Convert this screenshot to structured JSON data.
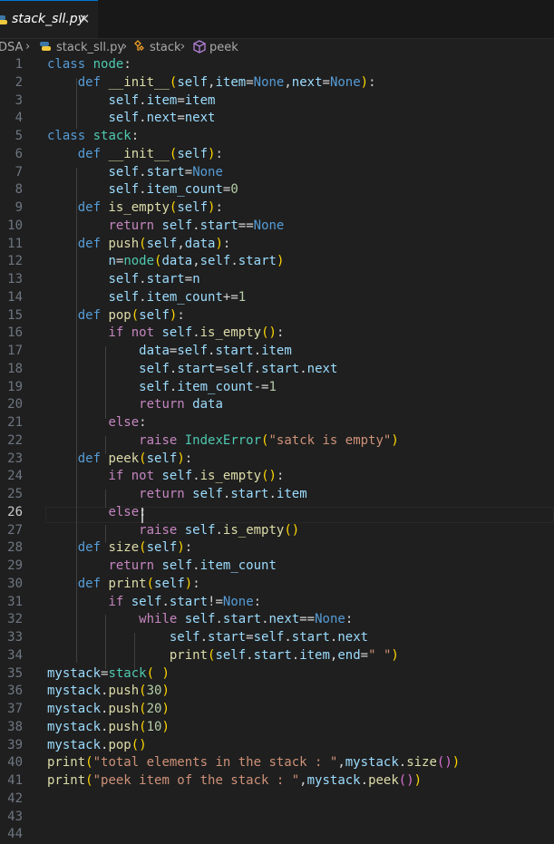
{
  "tabs": [
    {
      "label": "stack_sll.py",
      "active": true
    }
  ],
  "breadcrumb": [
    "DSA",
    "stack_sll.py",
    "stack",
    "peek"
  ],
  "editor": {
    "line_numbers": [
      "1",
      "2",
      "3",
      "4",
      "5",
      "6",
      "7",
      "8",
      "9",
      "10",
      "11",
      "12",
      "13",
      "14",
      "15",
      "16",
      "17",
      "18",
      "19",
      "20",
      "21",
      "22",
      "23",
      "24",
      "25",
      "26",
      "27",
      "28",
      "29",
      "30",
      "31",
      "32",
      "33",
      "34",
      "35",
      "36",
      "37",
      "38",
      "39",
      "40",
      "41",
      "42",
      "43",
      "44"
    ],
    "active_line": "26",
    "code_lines": [
      "class node:",
      "    def __init__(self,item=None,next=None):",
      "        self.item=item",
      "        self.next=next",
      "class stack:",
      "    def __init__(self):",
      "        self.start=None",
      "        self.item_count=0",
      "    def is_empty(self):",
      "        return self.start==None",
      "    def push(self,data):",
      "        n=node(data,self.start)",
      "        self.start=n",
      "        self.item_count+=1",
      "    def pop(self):",
      "        if not self.is_empty():",
      "            data=self.start.item",
      "            self.start=self.start.next",
      "            self.item_count-=1",
      "            return data",
      "        else:",
      "            raise IndexError(\"satck is empty\")",
      "    def peek(self):",
      "        if not self.is_empty():",
      "            return self.start.item",
      "        else:",
      "            raise self.is_empty()",
      "    def size(self):",
      "        return self.item_count",
      "    def print(self):",
      "        if self.start!=None:",
      "            while self.start.next==None:",
      "                self.start=self.start.next",
      "                print(self.start.item,end=\" \")",
      "mystack=stack( )",
      "mystack.push(30)",
      "mystack.push(20)",
      "mystack.push(10)",
      "mystack.pop()",
      "print(\"total elements in the stack : \",mystack.size())",
      "print(\"peek item of the stack : \",mystack.peek())",
      "",
      "",
      ""
    ]
  },
  "colors": {
    "background": "#1f1f1f",
    "tab_accent": "#0078d4",
    "keyword": "#569cd6",
    "control": "#c586c0",
    "function": "#dcdcaa",
    "class": "#4ec9b0",
    "variable": "#9cdcfe",
    "number": "#b5cea8",
    "string": "#ce9178"
  },
  "icons": [
    "python-file-icon",
    "close-icon",
    "chevron-right-icon",
    "class-symbol-icon",
    "method-symbol-icon"
  ]
}
